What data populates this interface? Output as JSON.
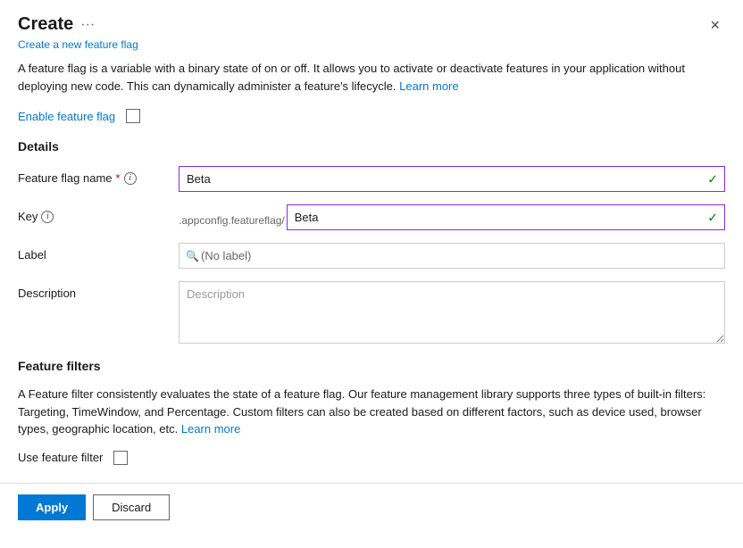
{
  "dialog": {
    "title": "Create",
    "ellipsis": "···",
    "subtitle": "Create a new feature flag",
    "close_label": "×"
  },
  "description": {
    "text_part1": "A feature flag is a variable with a binary state of on or off. It allows you to activate or deactivate features in your application without deploying new code. This can dynamically administer a feature's lifecycle.",
    "learn_more": "Learn more"
  },
  "enable_feature_flag": {
    "label": "Enable feature flag"
  },
  "details": {
    "section_title": "Details",
    "feature_flag_name": {
      "label": "Feature flag name",
      "required_marker": "*",
      "info": "i",
      "value": "Beta",
      "check": "✓"
    },
    "key": {
      "label": "Key",
      "info": "i",
      "prefix": ".appconfig.featureflag/",
      "value": "Beta",
      "check": "✓"
    },
    "label_field": {
      "label": "Label",
      "placeholder": "(No label)",
      "search_icon": "🔍"
    },
    "description_field": {
      "label": "Description",
      "placeholder": "Description"
    }
  },
  "feature_filters": {
    "section_title": "Feature filters",
    "description_part1": "A Feature filter consistently evaluates the state of a feature flag. Our feature management library supports three types of built-in filters: Targeting, TimeWindow, and Percentage. Custom filters can also be created based on different factors, such as device used, browser types, geographic location, etc.",
    "learn_more": "Learn more",
    "use_filter_label": "Use feature filter"
  },
  "footer": {
    "apply_label": "Apply",
    "discard_label": "Discard"
  }
}
